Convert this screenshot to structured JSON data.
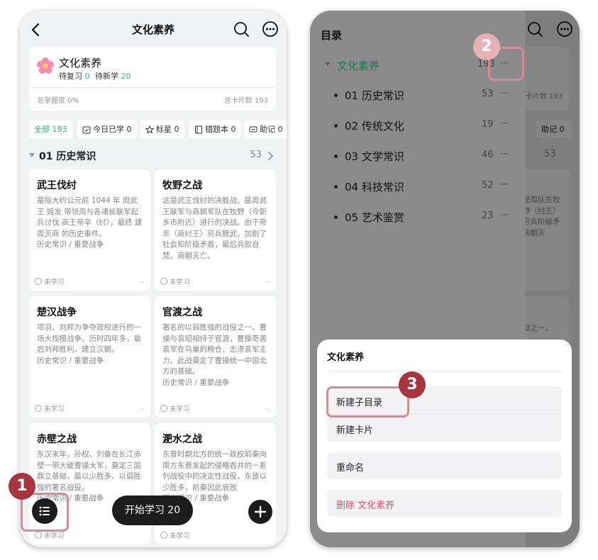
{
  "left": {
    "nav": {
      "title": "文化素养"
    },
    "deck": {
      "name": "文化素养",
      "review_label": "待复习",
      "review_count": "0",
      "new_label": "待新学",
      "new_count": "20",
      "mastery": "总掌握度 0%",
      "total": "总卡片数 193"
    },
    "filters": [
      {
        "label": "全部 193",
        "icon": ""
      },
      {
        "label": "今日已学 0",
        "icon": "calendar-check-icon"
      },
      {
        "label": "标星 0",
        "icon": "star-icon"
      },
      {
        "label": "错题本 0",
        "icon": "notebook-icon"
      },
      {
        "label": "助记 0",
        "icon": "comment-icon"
      }
    ],
    "section": {
      "title": "01 历史常识",
      "count": "53"
    },
    "cards": [
      {
        "title": "武王伐纣",
        "body": "是指大约公元前 1044 年 周武王 姬发 带领周与各诸侯联军起兵讨伐 商王帝辛（纣），最终 建周灭商 的历史事件。",
        "path": "历史常识 / 重要战争",
        "status": "未学习"
      },
      {
        "title": "牧野之战",
        "body": "这是武王伐纣的决胜战，是周武王联军与商朝军队在牧野（今新乡市附近）进行的决战。由于帝辛（商纣王）穷兵黩武，加剧了社会和阶级矛盾，最后兵败自焚，商朝灭亡。",
        "path": "",
        "status": "未学习"
      },
      {
        "title": "楚汉战争",
        "body": "项羽、刘邦为争夺政权进行的一场大规模战争。历时四年多，最后刘邦胜利，建立汉朝。",
        "path": "历史常识 / 重要战争",
        "status": "未学习"
      },
      {
        "title": "官渡之战",
        "body": "著名的以弱胜强的战役之一。曹操与袁绍相持于官渡，曹操奇袭袁军在乌巢的粮仓，击溃袁军主力。此战奠定了曹操统一中国北方的基础。",
        "path": "历史常识 / 重要战争",
        "status": "未学习"
      },
      {
        "title": "赤壁之战",
        "body": "东汉末年，孙权、刘备在长江赤壁一带大破曹操大军，奠定三国鼎立基础，是以少胜多、以弱胜强的著名战役。",
        "path": "历史常识 / 重要战争",
        "status": "未学习"
      },
      {
        "title": "淝水之战",
        "body": "东晋时期北方的统一政权前秦向南方东晋发起的侵略吞并的一系列战役中的决定性战役，东晋以少胜多，前秦因此衰败",
        "path": "历史常识 / 重要战争",
        "status": "未学习"
      }
    ],
    "start_button": "开始学习 20"
  },
  "right": {
    "drawer": {
      "title": "目录",
      "root": {
        "label": "文化素养",
        "count": "193",
        "more": "···"
      },
      "items": [
        {
          "label": "01 历史常识",
          "count": "53",
          "more": "···"
        },
        {
          "label": "02 传统文化",
          "count": "19",
          "more": "···"
        },
        {
          "label": "03 文学常识",
          "count": "46",
          "more": "···"
        },
        {
          "label": "04 科技常识",
          "count": "52",
          "more": "···"
        },
        {
          "label": "05 艺术鉴赏",
          "count": "23",
          "more": "···"
        }
      ]
    },
    "background": {
      "total": "卡片数 193",
      "chip": "助记 0",
      "count": "53",
      "card1": "是周队在牧野（纣王）穷兵阶级矛商朝灭",
      "card2": "役之一。"
    },
    "sheet": {
      "title": "文化素养",
      "new_folder": "新建子目录",
      "new_card": "新建卡片",
      "rename": "重命名",
      "delete_label": "删除",
      "delete_target": "文化素养"
    }
  },
  "badges": [
    "1",
    "2",
    "3"
  ]
}
